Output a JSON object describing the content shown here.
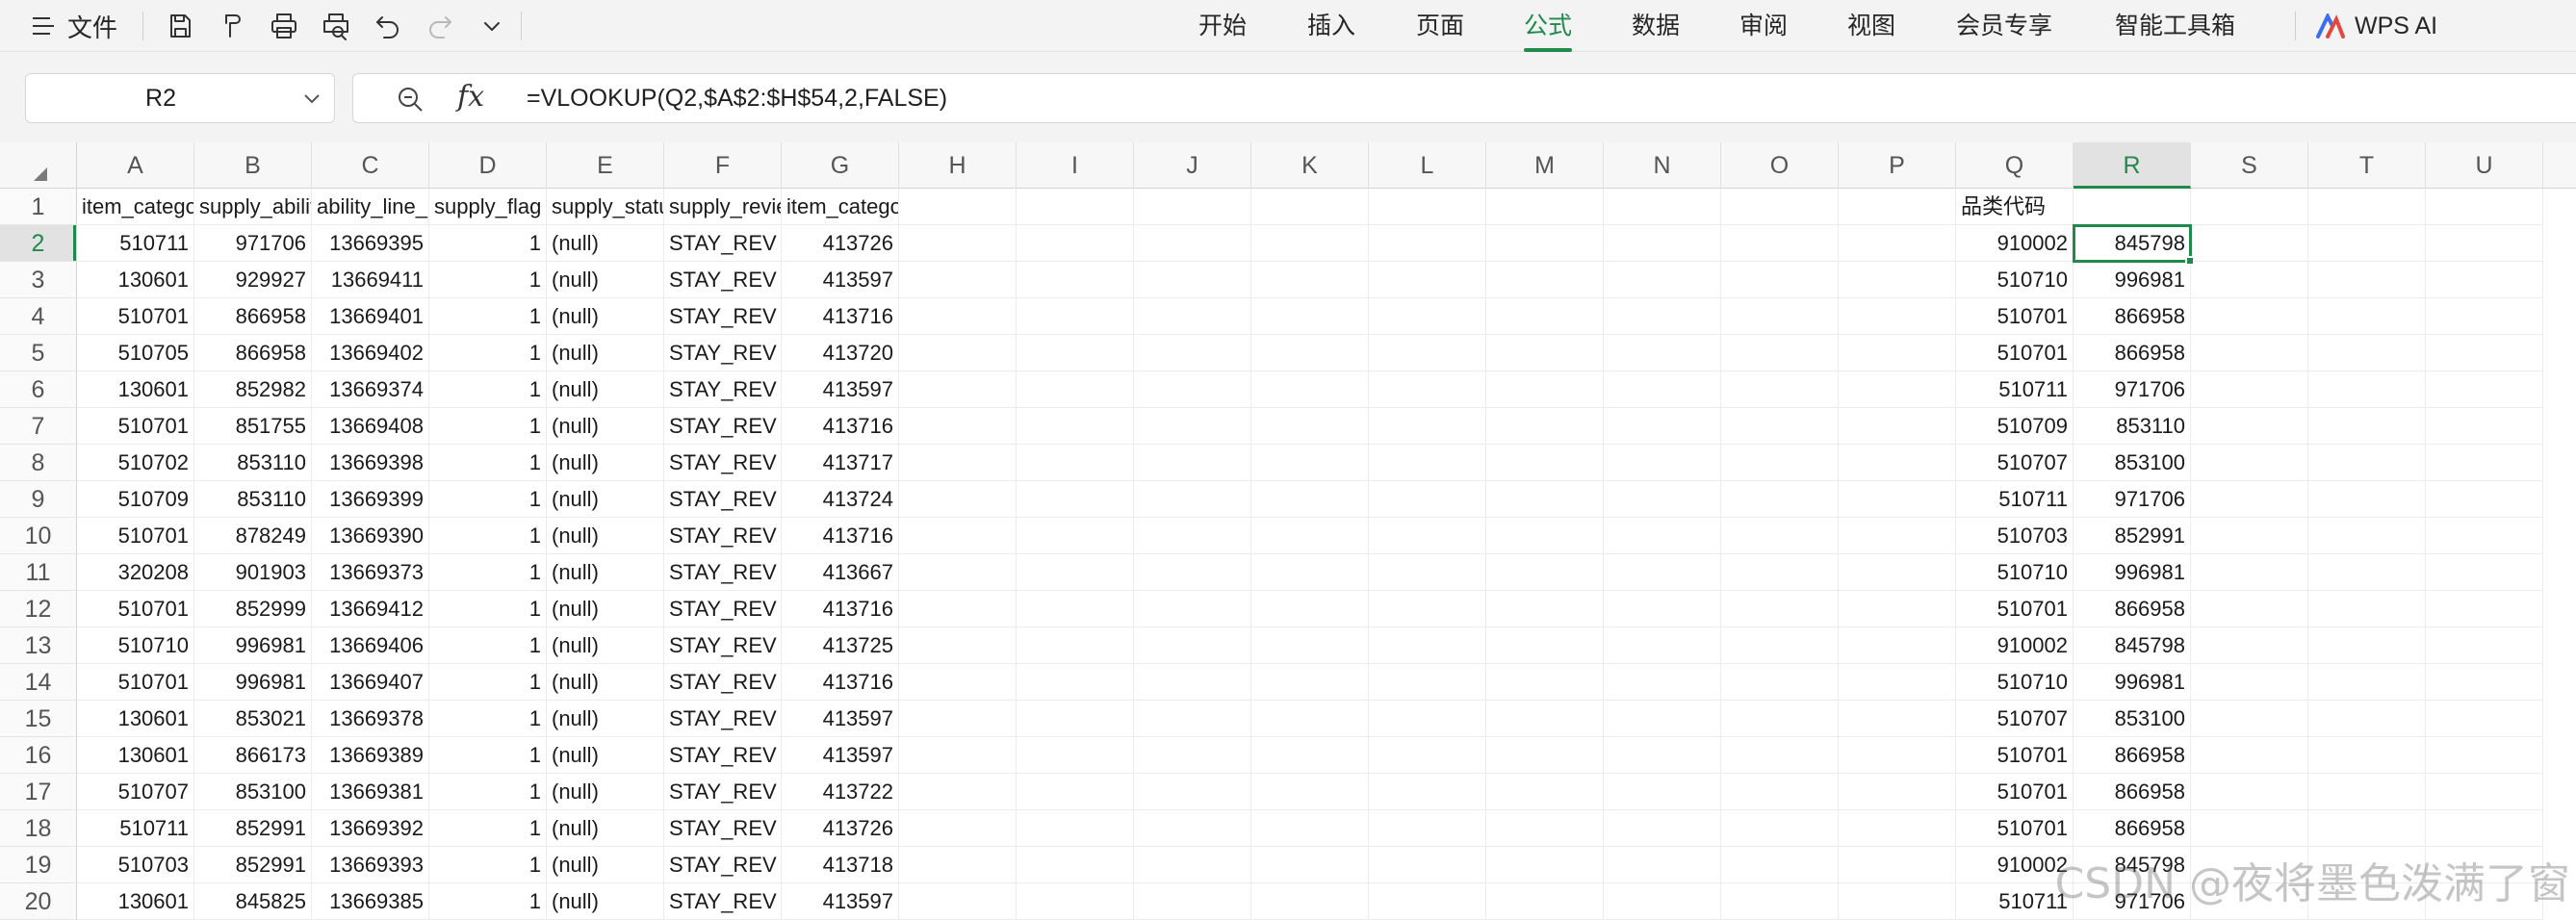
{
  "menu": {
    "file_label": "文件",
    "toolbar_icons": [
      "save-icon",
      "format-painter-icon",
      "print-icon",
      "print-preview-icon",
      "undo-icon",
      "redo-icon",
      "more-chevron-icon"
    ],
    "tabs": [
      {
        "label": "开始",
        "active": false
      },
      {
        "label": "插入",
        "active": false
      },
      {
        "label": "页面",
        "active": false
      },
      {
        "label": "公式",
        "active": true
      },
      {
        "label": "数据",
        "active": false
      },
      {
        "label": "审阅",
        "active": false
      },
      {
        "label": "视图",
        "active": false
      },
      {
        "label": "会员专享",
        "active": false
      },
      {
        "label": "智能工具箱",
        "active": false
      }
    ],
    "ai_label": "WPS AI"
  },
  "formula_bar": {
    "name_box": "R2",
    "fx_label": "fx",
    "formula": "=VLOOKUP(Q2,$A$2:$H$54,2,FALSE)"
  },
  "grid": {
    "columns": [
      "A",
      "B",
      "C",
      "D",
      "E",
      "F",
      "G",
      "H",
      "I",
      "J",
      "K",
      "L",
      "M",
      "N",
      "O",
      "P",
      "Q",
      "R",
      "S",
      "T",
      "U"
    ],
    "selected_column": "R",
    "selected_row": 2,
    "header_row": {
      "A": "item_category_id",
      "B": "supply_ability_id",
      "C": "ability_line_id",
      "D": "supply_flag",
      "E": "supply_status",
      "F": "supply_review_status",
      "G": "item_category_id",
      "Q": "品类代码"
    },
    "rows": [
      {
        "n": 2,
        "A": "510711",
        "B": "971706",
        "C": "13669395",
        "D": "1",
        "E": "(null)",
        "F": "STAY_REV",
        "G": "413726",
        "Q": "910002",
        "R": "845798"
      },
      {
        "n": 3,
        "A": "130601",
        "B": "929927",
        "C": "13669411",
        "D": "1",
        "E": "(null)",
        "F": "STAY_REV",
        "G": "413597",
        "Q": "510710",
        "R": "996981"
      },
      {
        "n": 4,
        "A": "510701",
        "B": "866958",
        "C": "13669401",
        "D": "1",
        "E": "(null)",
        "F": "STAY_REV",
        "G": "413716",
        "Q": "510701",
        "R": "866958"
      },
      {
        "n": 5,
        "A": "510705",
        "B": "866958",
        "C": "13669402",
        "D": "1",
        "E": "(null)",
        "F": "STAY_REV",
        "G": "413720",
        "Q": "510701",
        "R": "866958"
      },
      {
        "n": 6,
        "A": "130601",
        "B": "852982",
        "C": "13669374",
        "D": "1",
        "E": "(null)",
        "F": "STAY_REV",
        "G": "413597",
        "Q": "510711",
        "R": "971706"
      },
      {
        "n": 7,
        "A": "510701",
        "B": "851755",
        "C": "13669408",
        "D": "1",
        "E": "(null)",
        "F": "STAY_REV",
        "G": "413716",
        "Q": "510709",
        "R": "853110"
      },
      {
        "n": 8,
        "A": "510702",
        "B": "853110",
        "C": "13669398",
        "D": "1",
        "E": "(null)",
        "F": "STAY_REV",
        "G": "413717",
        "Q": "510707",
        "R": "853100"
      },
      {
        "n": 9,
        "A": "510709",
        "B": "853110",
        "C": "13669399",
        "D": "1",
        "E": "(null)",
        "F": "STAY_REV",
        "G": "413724",
        "Q": "510711",
        "R": "971706"
      },
      {
        "n": 10,
        "A": "510701",
        "B": "878249",
        "C": "13669390",
        "D": "1",
        "E": "(null)",
        "F": "STAY_REV",
        "G": "413716",
        "Q": "510703",
        "R": "852991"
      },
      {
        "n": 11,
        "A": "320208",
        "B": "901903",
        "C": "13669373",
        "D": "1",
        "E": "(null)",
        "F": "STAY_REV",
        "G": "413667",
        "Q": "510710",
        "R": "996981"
      },
      {
        "n": 12,
        "A": "510701",
        "B": "852999",
        "C": "13669412",
        "D": "1",
        "E": "(null)",
        "F": "STAY_REV",
        "G": "413716",
        "Q": "510701",
        "R": "866958"
      },
      {
        "n": 13,
        "A": "510710",
        "B": "996981",
        "C": "13669406",
        "D": "1",
        "E": "(null)",
        "F": "STAY_REV",
        "G": "413725",
        "Q": "910002",
        "R": "845798"
      },
      {
        "n": 14,
        "A": "510701",
        "B": "996981",
        "C": "13669407",
        "D": "1",
        "E": "(null)",
        "F": "STAY_REV",
        "G": "413716",
        "Q": "510710",
        "R": "996981"
      },
      {
        "n": 15,
        "A": "130601",
        "B": "853021",
        "C": "13669378",
        "D": "1",
        "E": "(null)",
        "F": "STAY_REV",
        "G": "413597",
        "Q": "510707",
        "R": "853100"
      },
      {
        "n": 16,
        "A": "130601",
        "B": "866173",
        "C": "13669389",
        "D": "1",
        "E": "(null)",
        "F": "STAY_REV",
        "G": "413597",
        "Q": "510701",
        "R": "866958"
      },
      {
        "n": 17,
        "A": "510707",
        "B": "853100",
        "C": "13669381",
        "D": "1",
        "E": "(null)",
        "F": "STAY_REV",
        "G": "413722",
        "Q": "510701",
        "R": "866958"
      },
      {
        "n": 18,
        "A": "510711",
        "B": "852991",
        "C": "13669392",
        "D": "1",
        "E": "(null)",
        "F": "STAY_REV",
        "G": "413726",
        "Q": "510701",
        "R": "866958"
      },
      {
        "n": 19,
        "A": "510703",
        "B": "852991",
        "C": "13669393",
        "D": "1",
        "E": "(null)",
        "F": "STAY_REV",
        "G": "413718",
        "Q": "910002",
        "R": "845798"
      },
      {
        "n": 20,
        "A": "130601",
        "B": "845825",
        "C": "13669385",
        "D": "1",
        "E": "(null)",
        "F": "STAY_REV",
        "G": "413597",
        "Q": "510711",
        "R": "971706"
      }
    ]
  },
  "watermark": "CSDN @夜将墨色泼满了窗",
  "colors": {
    "accent": "#1f8a4c",
    "ribbon_bg": "#f3f3f3"
  }
}
